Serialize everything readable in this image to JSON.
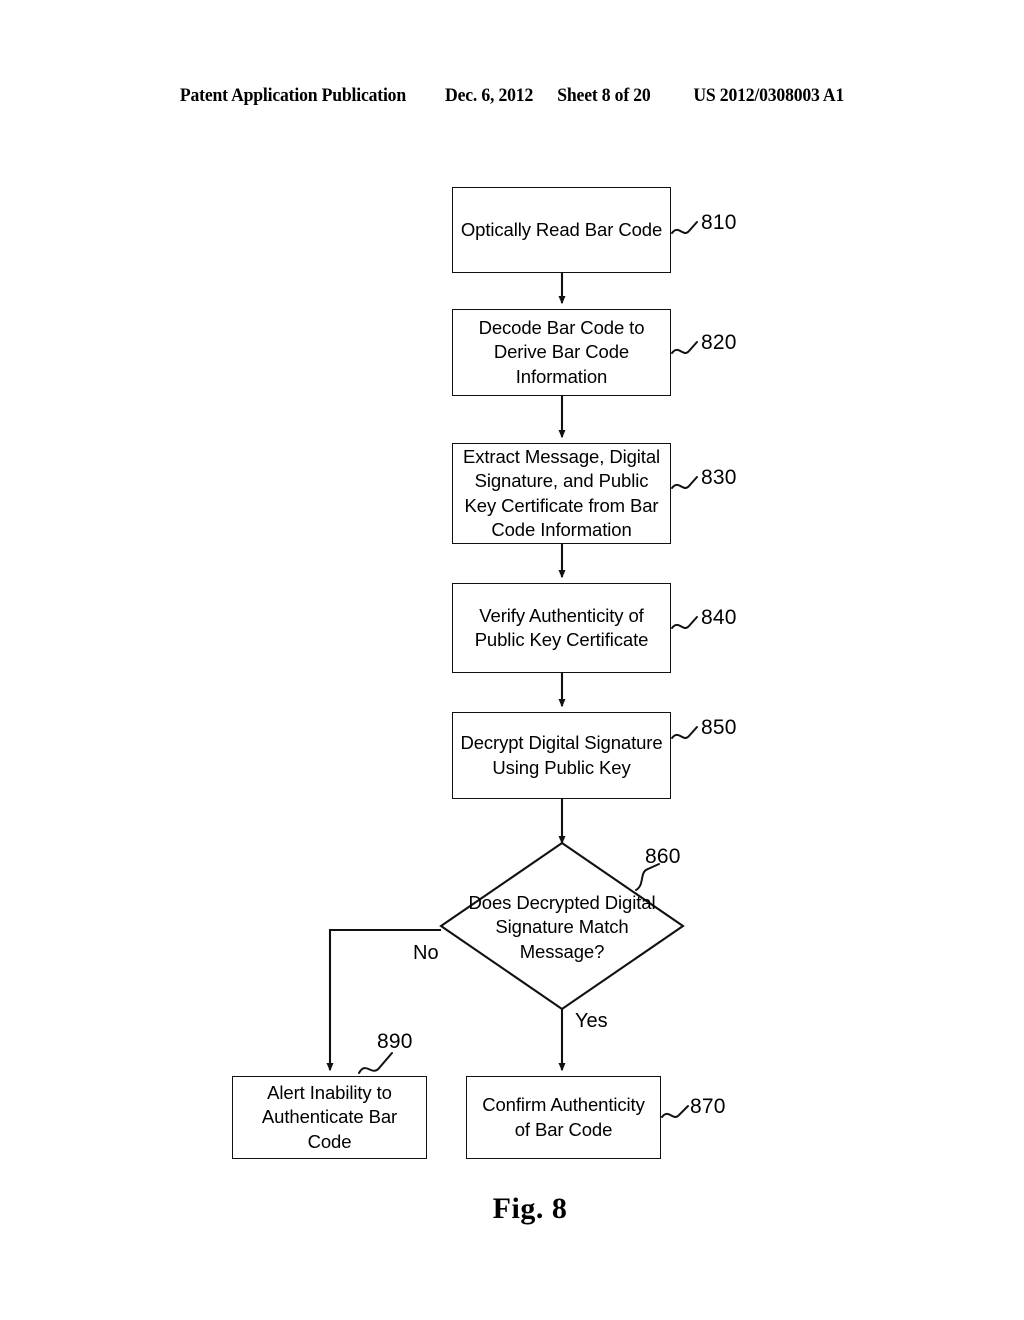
{
  "header": {
    "publication": "Patent Application Publication",
    "date": "Dec. 6, 2012",
    "sheet": "Sheet 8 of 20",
    "document_number": "US 2012/0308003 A1"
  },
  "figure": {
    "caption": "Fig. 8",
    "type": "flowchart",
    "nodes": [
      {
        "ref": "810",
        "shape": "process",
        "text": "Optically Read Bar Code"
      },
      {
        "ref": "820",
        "shape": "process",
        "text": "Decode Bar Code to Derive Bar Code Information"
      },
      {
        "ref": "830",
        "shape": "process",
        "text": "Extract Message, Digital Signature, and Public Key Certificate from Bar Code Information"
      },
      {
        "ref": "840",
        "shape": "process",
        "text": "Verify Authenticity of Public Key Certificate"
      },
      {
        "ref": "850",
        "shape": "process",
        "text": "Decrypt Digital Signature Using Public Key"
      },
      {
        "ref": "860",
        "shape": "decision",
        "text": "Does Decrypted Digital Signature Match Message?"
      },
      {
        "ref": "870",
        "shape": "process",
        "text": "Confirm Authenticity of Bar Code"
      },
      {
        "ref": "890",
        "shape": "process",
        "text": "Alert Inability to Authenticate Bar Code"
      }
    ],
    "branch_labels": {
      "no": "No",
      "yes": "Yes"
    },
    "line_color": "#111111",
    "background_color": "#ffffff"
  }
}
